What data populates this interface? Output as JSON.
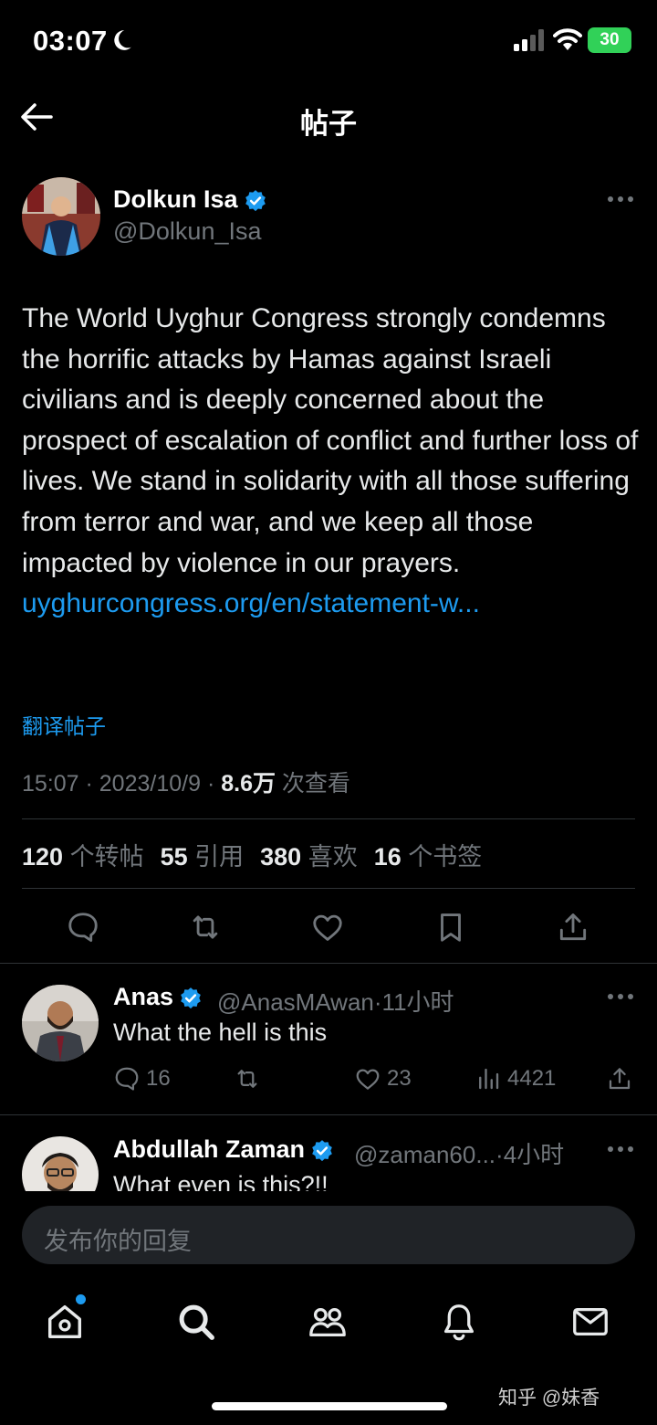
{
  "status_bar": {
    "time": "03:07",
    "battery": "30"
  },
  "header": {
    "title": "帖子"
  },
  "post": {
    "author_name": "Dolkun Isa",
    "author_handle": "@Dolkun_Isa",
    "text": "The World Uyghur Congress strongly condemns the horrific attacks by Hamas against Israeli civilians and is deeply concerned about the prospect of escalation of conflict and further loss of lives. We stand in solidarity with all those suffering from terror and war, and we keep all those impacted by violence in our prayers.",
    "link": "uyghurcongress.org/en/statement-w...",
    "translate_label": "翻译帖子",
    "timestamp": "15:07 · 2023/10/9 · ",
    "views_count": "8.6万",
    "views_label": " 次查看",
    "stats": {
      "reposts_count": "120",
      "reposts_label": " 个转帖",
      "quotes_count": "55",
      "quotes_label": " 引用",
      "likes_count": "380",
      "likes_label": " 喜欢",
      "bookmarks_count": "16",
      "bookmarks_label": " 个书签"
    }
  },
  "replies": [
    {
      "name": "Anas",
      "handle": "@AnasMAwan",
      "time": "·11小时",
      "text": "What the hell is this",
      "replies_count": "16",
      "likes_count": "23",
      "views_count": "4421"
    },
    {
      "name": "Abdullah Zaman",
      "handle": "@zaman60...",
      "time": "·4小时",
      "text": "What even is this?!!"
    }
  ],
  "compose": {
    "placeholder": "发布你的回复"
  },
  "watermark": "知乎 @妹香",
  "colors": {
    "accent": "#1d9bf0",
    "background": "#000000",
    "muted": "#71767b"
  }
}
